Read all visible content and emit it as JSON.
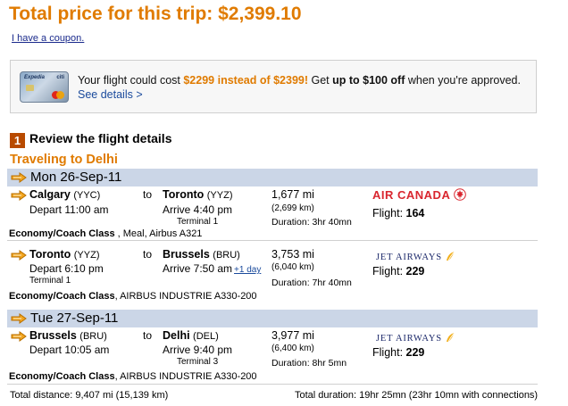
{
  "header": {
    "total_price": "Total price for this trip: $2,399.10",
    "coupon_link": "I have a coupon."
  },
  "promo": {
    "card_brand": "Expedia",
    "card_bank": "citi",
    "text_1": "Your flight could cost ",
    "highlight": "$2299 instead of $2399!",
    "text_2": " Get ",
    "bold": "up to $100 off",
    "text_3": " when you're approved. ",
    "details_link": "See details >"
  },
  "review": {
    "step_number": "1",
    "heading": "Review the flight details",
    "traveling": "Traveling to Delhi"
  },
  "dates": [
    "Mon 26-Sep-11",
    "Tue 27-Sep-11"
  ],
  "legs": [
    {
      "from_city": "Calgary",
      "from_code": "(YYC)",
      "depart": "Depart 11:00 am",
      "to_word": "to",
      "to_city": "Toronto",
      "to_code": "(YYZ)",
      "arrive": "Arrive 4:40 pm",
      "terminal": "Terminal 1",
      "miles": "1,677 mi",
      "km": "(2,699 km)",
      "duration": "Duration: 3hr 40mn",
      "airline_logo": "AIR CANADA",
      "flight_label": "Flight: ",
      "flight_no": "164",
      "class_bold": "Economy/Coach Class",
      "class_rest": " , Meal, Airbus A321"
    },
    {
      "from_city": "Toronto",
      "from_code": "(YYZ)",
      "depart": "Depart 6:10 pm",
      "from_terminal": "Terminal 1",
      "to_word": "to",
      "to_city": "Brussels",
      "to_code": "(BRU)",
      "arrive": "Arrive 7:50 am",
      "plus_day": "+1 day",
      "miles": "3,753 mi",
      "km": "(6,040 km)",
      "duration": "Duration: 7hr 40mn",
      "airline_logo": "JET AIRWAYS",
      "flight_label": "Flight: ",
      "flight_no": "229",
      "class_bold": "Economy/Coach Class",
      "class_rest": ", AIRBUS INDUSTRIE A330-200"
    },
    {
      "from_city": "Brussels",
      "from_code": "(BRU)",
      "depart": "Depart 10:05 am",
      "to_word": "to",
      "to_city": "Delhi",
      "to_code": "(DEL)",
      "arrive": "Arrive 9:40 pm",
      "terminal": "Terminal 3",
      "miles": "3,977 mi",
      "km": "(6,400 km)",
      "duration": "Duration: 8hr 5mn",
      "airline_logo": "JET AIRWAYS",
      "flight_label": "Flight: ",
      "flight_no": "229",
      "class_bold": "Economy/Coach Class",
      "class_rest": ", AIRBUS INDUSTRIE A330-200"
    }
  ],
  "footer": {
    "total_distance": "Total distance: 9,407 mi (15,139 km)",
    "total_duration": "Total duration: 19hr 25mn (23hr 10mn with connections)"
  },
  "colors": {
    "accent_orange": "#e07b00",
    "date_bar": "#cbd6e7",
    "air_canada_red": "#d9262f",
    "jet_airways_navy": "#1d2a6b",
    "jet_airways_gold": "#f2b01e",
    "step_badge": "#b84a00"
  }
}
